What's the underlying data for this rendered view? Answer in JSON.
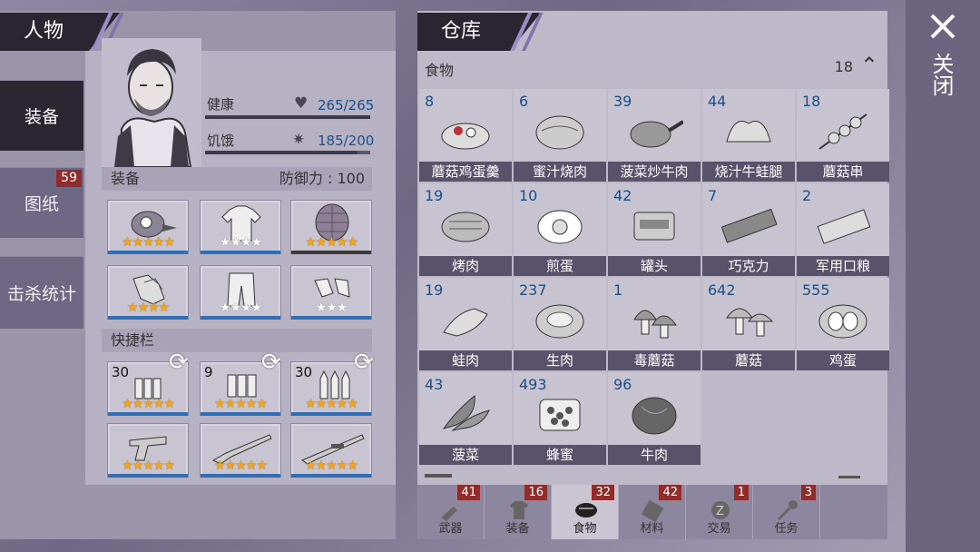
{
  "character_panel": {
    "title": "人物",
    "nav": [
      {
        "label": "装备",
        "active": true,
        "badge": ""
      },
      {
        "label": "图纸",
        "active": false,
        "badge": "59"
      },
      {
        "label": "击杀统计",
        "active": false,
        "badge": ""
      }
    ],
    "stats": {
      "health": {
        "label": "健康",
        "value": "265/265",
        "fraction": 1.0
      },
      "hunger": {
        "label": "饥饿",
        "value": "185/200",
        "fraction": 0.925
      }
    },
    "equipment": {
      "label": "装备",
      "defense_label": "防御力 : 100",
      "slots": [
        {
          "item": "helmet",
          "stars": 5,
          "filled_stars": 5
        },
        {
          "item": "shirt",
          "stars": 4,
          "filled_stars": 0
        },
        {
          "item": "body-armor",
          "stars": 5,
          "filled_stars": 5
        },
        {
          "item": "gloves",
          "stars": 4,
          "filled_stars": 4
        },
        {
          "item": "pants",
          "stars": 4,
          "filled_stars": 0
        },
        {
          "item": "shoes",
          "stars": 3,
          "filled_stars": 0
        }
      ]
    },
    "quickbar": {
      "label": "快捷栏",
      "slots": [
        {
          "item": "ammo-shotgun",
          "count": "30",
          "stars": 5,
          "filled_stars": 5
        },
        {
          "item": "ammo-shells",
          "count": "9",
          "stars": 5,
          "filled_stars": 5
        },
        {
          "item": "ammo-rifle",
          "count": "30",
          "stars": 5,
          "filled_stars": 5
        },
        {
          "item": "revolver",
          "count": "",
          "stars": 5,
          "filled_stars": 5
        },
        {
          "item": "shotgun",
          "count": "",
          "stars": 5,
          "filled_stars": 5
        },
        {
          "item": "rifle",
          "count": "",
          "stars": 5,
          "filled_stars": 5
        }
      ]
    }
  },
  "warehouse": {
    "title": "仓库",
    "category": "食物",
    "category_count": "18",
    "items": [
      {
        "count": "8",
        "name": "蘑菇鸡蛋羹",
        "icon": "bowl-icon"
      },
      {
        "count": "6",
        "name": "蜜汁烧肉",
        "icon": "roast-icon"
      },
      {
        "count": "39",
        "name": "菠菜炒牛肉",
        "icon": "pan-icon"
      },
      {
        "count": "44",
        "name": "烧汁牛蛙腿",
        "icon": "frog-legs-icon"
      },
      {
        "count": "18",
        "name": "蘑菇串",
        "icon": "skewer-icon"
      },
      {
        "count": "19",
        "name": "烤肉",
        "icon": "grilled-meat-icon"
      },
      {
        "count": "10",
        "name": "煎蛋",
        "icon": "fried-egg-icon"
      },
      {
        "count": "42",
        "name": "罐头",
        "icon": "can-icon"
      },
      {
        "count": "7",
        "name": "巧克力",
        "icon": "chocolate-icon"
      },
      {
        "count": "2",
        "name": "军用口粮",
        "icon": "ration-icon"
      },
      {
        "count": "19",
        "name": "蛙肉",
        "icon": "frog-meat-icon"
      },
      {
        "count": "237",
        "name": "生肉",
        "icon": "raw-meat-icon"
      },
      {
        "count": "1",
        "name": "毒蘑菇",
        "icon": "poison-mushroom-icon"
      },
      {
        "count": "642",
        "name": "蘑菇",
        "icon": "mushroom-icon"
      },
      {
        "count": "555",
        "name": "鸡蛋",
        "icon": "eggs-icon"
      },
      {
        "count": "43",
        "name": "菠菜",
        "icon": "spinach-icon"
      },
      {
        "count": "493",
        "name": "蜂蜜",
        "icon": "honeycomb-icon"
      },
      {
        "count": "96",
        "name": "牛肉",
        "icon": "beef-icon"
      }
    ],
    "tabs": [
      {
        "label": "武器",
        "badge": "41",
        "icon": "weapon-icon",
        "active": false
      },
      {
        "label": "装备",
        "badge": "16",
        "icon": "shirt-icon",
        "active": false
      },
      {
        "label": "食物",
        "badge": "32",
        "icon": "meat-icon",
        "active": true
      },
      {
        "label": "材料",
        "badge": "42",
        "icon": "material-icon",
        "active": false
      },
      {
        "label": "交易",
        "badge": "1",
        "icon": "coin-icon",
        "active": false
      },
      {
        "label": "任务",
        "badge": "3",
        "icon": "key-icon",
        "active": false
      }
    ]
  },
  "close": {
    "label": "关闭",
    "icon": "close-icon"
  }
}
